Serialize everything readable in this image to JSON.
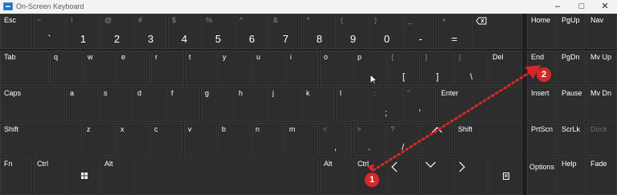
{
  "window": {
    "title": "On-Screen Keyboard"
  },
  "keys": {
    "esc": "Esc",
    "tilde": "~",
    "backtick": "`",
    "n1": "1",
    "s1": "!",
    "n2": "2",
    "s2": "@",
    "n3": "3",
    "s3": "#",
    "n4": "4",
    "s4": "$",
    "n5": "5",
    "s5": "%",
    "n6": "6",
    "s6": "^",
    "n7": "7",
    "s7": "&",
    "n8": "8",
    "s8": "*",
    "n9": "9",
    "s9": "(",
    "n0": "0",
    "s0": ")",
    "minus": "-",
    "underscore": "_",
    "equals": "=",
    "plus": "+",
    "tab": "Tab",
    "q": "q",
    "w": "w",
    "e": "e",
    "r": "r",
    "t": "t",
    "y": "y",
    "u": "u",
    "i": "i",
    "o": "o",
    "p": "p",
    "lbrace": "{",
    "lbracket": "[",
    "rbrace": "}",
    "rbracket": "]",
    "pipe": "|",
    "backslash": "\\",
    "del": "Del",
    "caps": "Caps",
    "a": "a",
    "s": "s",
    "d": "d",
    "f": "f",
    "g": "g",
    "h": "h",
    "j": "j",
    "k": "k",
    "l": "l",
    "colon": ":",
    "semicolon": ";",
    "quote": "\"",
    "apostrophe": "'",
    "enter": "Enter",
    "shift": "Shift",
    "z": "z",
    "x": "x",
    "c": "c",
    "v": "v",
    "b": "b",
    "n": "n",
    "m": "m",
    "lt": "<",
    "comma": ",",
    "gt": ">",
    "period": ".",
    "question": "?",
    "slash": "/",
    "fn": "Fn",
    "ctrl": "Ctrl",
    "alt": "Alt",
    "home": "Home",
    "pgup": "PgUp",
    "nav": "Nav",
    "end": "End",
    "pgdn": "PgDn",
    "mvup": "Mv Up",
    "insert": "Insert",
    "pause": "Pause",
    "mvdn": "Mv Dn",
    "prtscn": "PrtScn",
    "scrlk": "ScrLk",
    "dock": "Dock",
    "options": "Options",
    "help": "Help",
    "fade": "Fade"
  },
  "annotations": {
    "marker1": "1",
    "marker2": "2",
    "color": "#d62828"
  },
  "colors": {
    "key_bg": "#2d2d2d",
    "board_bg": "#1f1f1f",
    "text": "#ffffff",
    "secondary": "#8a8a8a"
  }
}
